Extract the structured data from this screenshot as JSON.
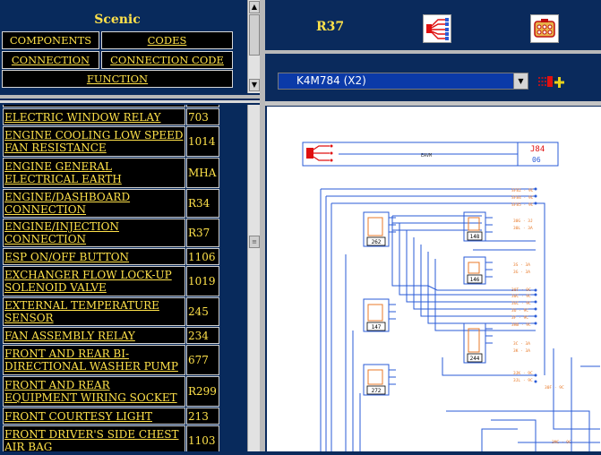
{
  "nav": {
    "vehicle": "Scenic",
    "components": "COMPONENTS",
    "codes": "CODES",
    "connection": "CONNECTION",
    "connection_code": "CONNECTION CODE",
    "function": "FUNCTION"
  },
  "header": {
    "connector_code": "R37",
    "wiring_icon": "wiring-harness-icon",
    "connector_icon": "connector-pinout-icon"
  },
  "selector": {
    "value": "K4M784 (X2)",
    "add_icon": "add-connection-icon"
  },
  "list": [
    {
      "name": "ELECTRIC WINDOW RELAY",
      "code": "703"
    },
    {
      "name": "ENGINE COOLING LOW SPEED FAN RESISTANCE",
      "code": "1014"
    },
    {
      "name": "ENGINE GENERAL ELECTRICAL EARTH",
      "code": "MHA"
    },
    {
      "name": "ENGINE/DASHBOARD CONNECTION",
      "code": "R34"
    },
    {
      "name": "ENGINE/INJECTION CONNECTION",
      "code": "R37"
    },
    {
      "name": "ESP ON/OFF BUTTON",
      "code": "1106"
    },
    {
      "name": "EXCHANGER FLOW LOCK-UP SOLENOID VALVE",
      "code": "1019"
    },
    {
      "name": "EXTERNAL TEMPERATURE SENSOR",
      "code": "245"
    },
    {
      "name": "FAN ASSEMBLY RELAY",
      "code": "234"
    },
    {
      "name": "FRONT AND REAR BI-DIRECTIONAL WASHER PUMP",
      "code": "677"
    },
    {
      "name": "FRONT AND REAR EQUIPMENT WIRING SOCKET",
      "code": "R299"
    },
    {
      "name": "FRONT COURTESY LIGHT",
      "code": "213"
    },
    {
      "name": "FRONT DRIVER'S SIDE CHEST AIR BAG",
      "code": "1103"
    }
  ],
  "diagram": {
    "connector_ref": "J84",
    "connector_sub": "06",
    "harness_label": "EAVM",
    "components": [
      "262",
      "148",
      "146",
      "147",
      "244",
      "272"
    ]
  },
  "colors": {
    "panel_bg": "#0a2a5c",
    "accent_yellow": "#ffe24a",
    "select_blue": "#0b3aa8",
    "wire_blue": "#2a5bd7",
    "wire_orange": "#e87a2a",
    "connector_red": "#e01010"
  }
}
